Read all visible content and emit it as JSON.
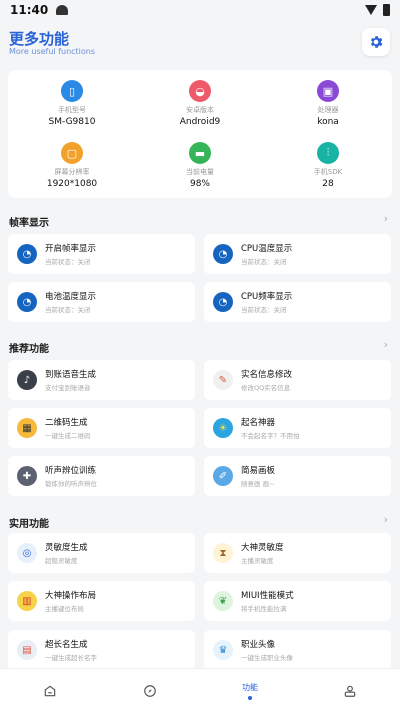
{
  "status": {
    "time": "11:40"
  },
  "header": {
    "title": "更多功能",
    "subtitle": "More useful functions"
  },
  "info": [
    {
      "label": "手机型号",
      "value": "SM-G9810",
      "icon": "phone-icon",
      "color": "#2b8ae6"
    },
    {
      "label": "安卓版本",
      "value": "Android9",
      "icon": "android-icon",
      "color": "#ef5a6a"
    },
    {
      "label": "处理器",
      "value": "kona",
      "icon": "chip-icon",
      "color": "#8a4ad6"
    },
    {
      "label": "屏幕分辨率",
      "value": "1920*1080",
      "icon": "screen-icon",
      "color": "#f2a22a"
    },
    {
      "label": "当前电量",
      "value": "98%",
      "icon": "battery-icon",
      "color": "#36b45a"
    },
    {
      "label": "手机SDK",
      "value": "28",
      "icon": "sliders-icon",
      "color": "#17b3a3"
    }
  ],
  "sections": {
    "fps": {
      "title": "帧率显示",
      "arrow": "›",
      "items": [
        {
          "title": "开启帧率显示",
          "sub": "当前状态：关闭",
          "icon": "speedometer-icon"
        },
        {
          "title": "CPU温度显示",
          "sub": "当前状态：关闭",
          "icon": "speedometer-icon"
        },
        {
          "title": "电池温度显示",
          "sub": "当前状态：关闭",
          "icon": "speedometer-icon"
        },
        {
          "title": "CPU频率显示",
          "sub": "当前状态：关闭",
          "icon": "speedometer-icon"
        }
      ]
    },
    "recommend": {
      "title": "推荐功能",
      "arrow": "›",
      "items": [
        {
          "title": "到账语音生成",
          "sub": "支付宝到账语音",
          "icon": "speaker-icon"
        },
        {
          "title": "实名信息修改",
          "sub": "修改QQ实名信息",
          "icon": "wrench-icon"
        },
        {
          "title": "二维码生成",
          "sub": "一键生成二维码",
          "icon": "qrcode-icon"
        },
        {
          "title": "起名神器",
          "sub": "不会起名字？不用怕",
          "icon": "lightbulb-icon"
        },
        {
          "title": "听声辨位训练",
          "sub": "锻炼你的听声辨位",
          "icon": "gamepad-icon"
        },
        {
          "title": "简易画板",
          "sub": "随意画 画~",
          "icon": "palette-icon"
        }
      ]
    },
    "practical": {
      "title": "实用功能",
      "arrow": "›",
      "items": [
        {
          "title": "灵敏度生成",
          "sub": "超稳灵敏度",
          "icon": "target-icon"
        },
        {
          "title": "大神灵敏度",
          "sub": "主播灵敏度",
          "icon": "hourglass-icon"
        },
        {
          "title": "大神操作布局",
          "sub": "主播键位布局",
          "icon": "layout-icon"
        },
        {
          "title": "MIUI性能模式",
          "sub": "将手机性能拉满",
          "icon": "leaf-icon"
        },
        {
          "title": "超长名生成",
          "sub": "一键生成超长名字",
          "icon": "chart-icon"
        },
        {
          "title": "职业头像",
          "sub": "一键生成职业头像",
          "icon": "trophy-icon"
        }
      ]
    }
  },
  "nav": {
    "active_label": "功能"
  }
}
